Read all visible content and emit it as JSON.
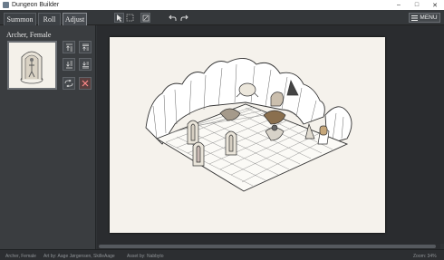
{
  "window": {
    "title": "Dungeon Builder",
    "controls": [
      "–",
      "□",
      "✕"
    ]
  },
  "tabs": [
    {
      "label": "Summon",
      "active": false
    },
    {
      "label": "Roll",
      "active": false
    },
    {
      "label": "Adjust",
      "active": true
    }
  ],
  "toolbar": {
    "tools": [
      "pointer-icon",
      "select-box-icon",
      "frame-icon"
    ],
    "history": [
      "undo-icon",
      "redo-icon"
    ],
    "menu_label": "MENU"
  },
  "sidebar": {
    "selected_name": "Archer, Female",
    "actions": [
      "bring-forward-icon",
      "send-backward-icon",
      "bring-to-front-icon",
      "send-to-back-icon",
      "flip-icon",
      "delete-icon"
    ]
  },
  "statusbar": {
    "name": "Archer, Female",
    "art_credit": "Art by: Aage Jørgensen, SkilleAage",
    "asset_credit": "Asset by: Nabbyto",
    "zoom": "Zoom: 34%"
  },
  "colors": {
    "accent_danger": "#ff8a8a",
    "paper": "#f5f2ec",
    "panel": "#3a3d40"
  }
}
